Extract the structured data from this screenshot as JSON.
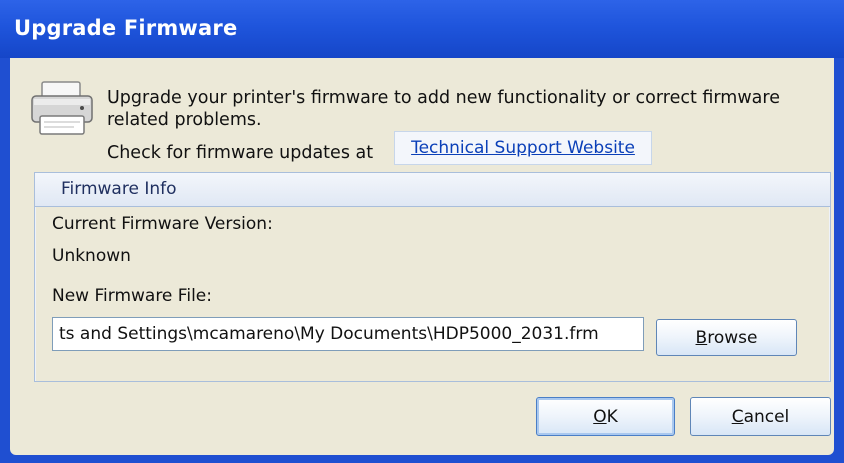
{
  "window": {
    "title": "Upgrade Firmware"
  },
  "intro": {
    "description": "Upgrade your printer's firmware to add new functionality or correct firmware related problems.",
    "check_label": "Check for firmware updates at",
    "support_link": "Technical Support Website"
  },
  "firmware_info": {
    "group_title": "Firmware Info",
    "current_version_label": "Current Firmware Version:",
    "current_version_value": "Unknown",
    "new_file_label": "New Firmware File:",
    "new_file_value": "ts and Settings\\mcamareno\\My Documents\\HDP5000_2031.frm",
    "browse_label": "Browse",
    "browse_mnemonic": "B",
    "browse_rest": "rowse"
  },
  "buttons": {
    "ok_label": "OK",
    "ok_mnemonic": "O",
    "ok_rest": "K",
    "cancel_label": "Cancel",
    "cancel_mnemonic": "C",
    "cancel_rest": "ancel"
  },
  "icons": {
    "printer": "printer-icon"
  },
  "colors": {
    "titlebar": "#1f55dc",
    "dialog_bg": "#ece9d8",
    "link": "#0a3fb8",
    "group_border": "#a9bedb"
  }
}
